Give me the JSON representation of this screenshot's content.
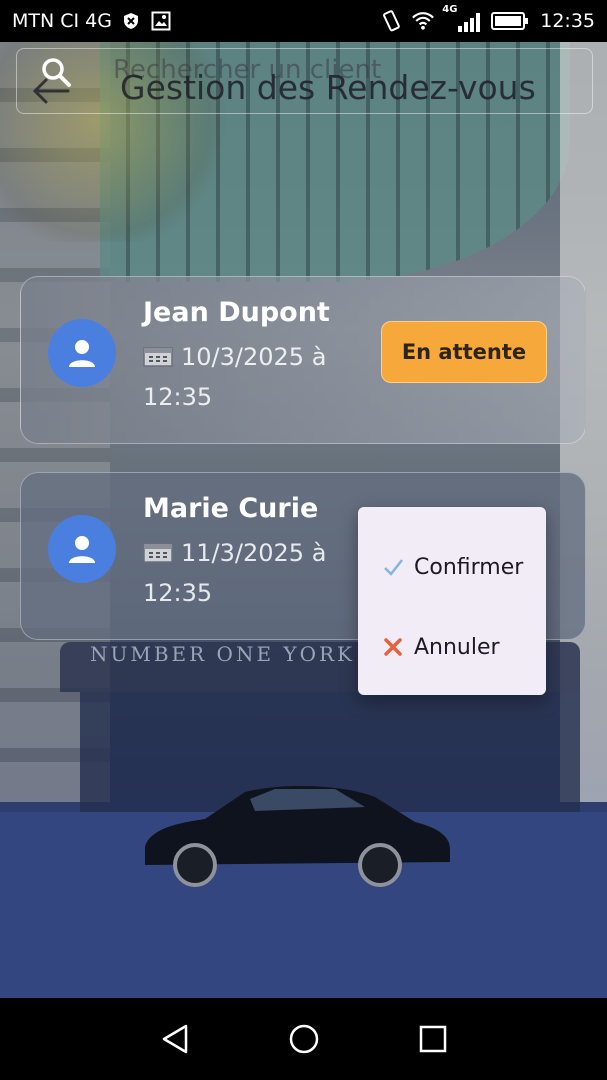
{
  "status_bar": {
    "carrier": "MTN CI 4G",
    "network_label": "4G",
    "time": "12:35"
  },
  "header": {
    "search_placeholder": "Rechercher un client",
    "title": "Gestion des Rendez-vous"
  },
  "background": {
    "canopy_sign": "NUMBER ONE YORK QUAY"
  },
  "appointments": [
    {
      "name": "Jean Dupont",
      "date": "10/3/2025 à",
      "time": "12:35",
      "status": "En attente"
    },
    {
      "name": "Marie Curie",
      "date": "11/3/2025 à",
      "time": "12:35"
    }
  ],
  "popup_menu": {
    "items": [
      {
        "label": "Confirmer",
        "icon": "check-icon"
      },
      {
        "label": "Annuler",
        "icon": "close-icon"
      }
    ]
  },
  "colors": {
    "avatar": "#4a7fe0",
    "status_pending": "#f7a83a",
    "menu_bg": "#f2ecf7",
    "confirm_check": "#7fb6e6",
    "cancel_x": "#e8603c"
  }
}
